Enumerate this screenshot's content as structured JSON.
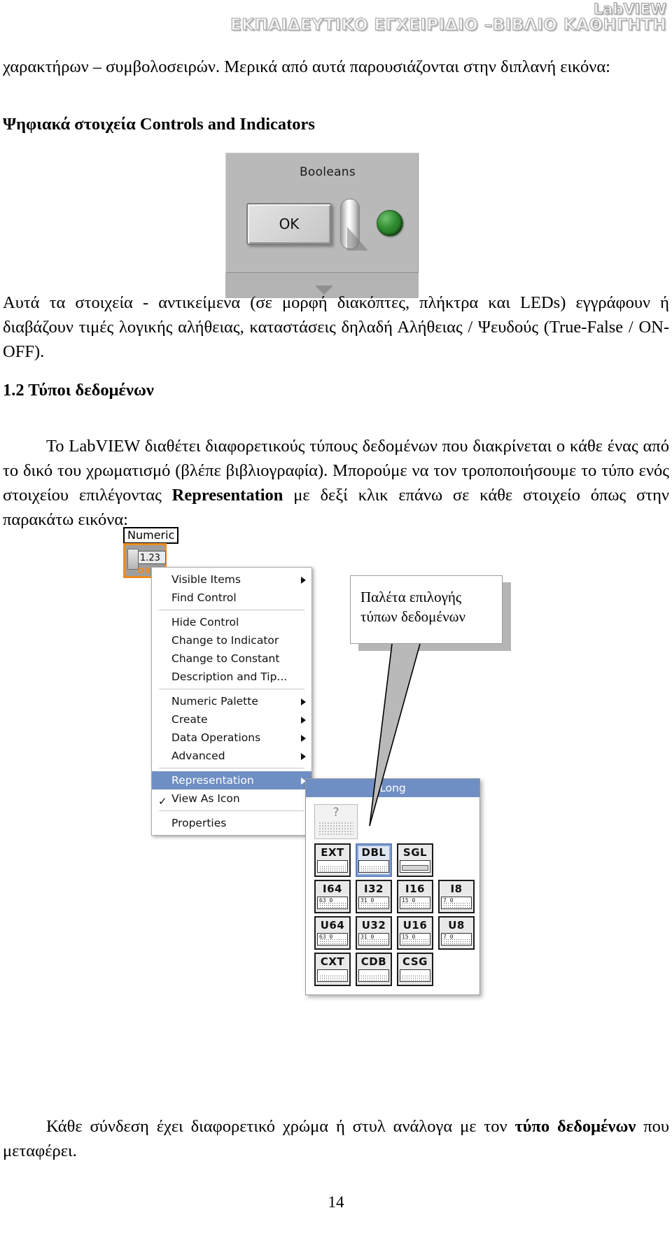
{
  "header": {
    "line1": "LabVIEW",
    "line2": "ΕΚΠΑΙΔΕΥΤΙΚΟ ΕΓΧΕΙΡΙΔΙΟ –ΒΙΒΛΙΟ ΚΑΘΗΓΗΤΗ"
  },
  "body": {
    "intro": "χαρακτήρων – συμβολοσειρών.  Μερικά από αυτά παρουσιάζονται στην διπλανή εικόνα:",
    "heading_digital": "Ψηφιακά στοιχεία  Controls and Indicators",
    "para_auta": "Αυτά τα στοιχεία - αντικείμενα (σε μορφή διακόπτες, πλήκτρα και LEDs) εγγράφουν ή διαβάζουν τιμές λογικής αλήθειας, καταστάσεις δηλαδή Αλήθειας / Ψευδούς (True-False / ON-OFF).",
    "heading_12": "1.2 Τύποι δεδομένων",
    "para_lab_1": "Το LabVIEW διαθέτει διαφορετικούς τύπους δεδομένων που διακρίνεται ο κάθε ένας από το δικό του χρωματισμό (βλέπε βιβλιογραφία). Μπορούμε να τον τροποποιήσουμε το τύπο ενός στοιχείου επιλέγοντας ",
    "para_lab_bold": "Representation",
    "para_lab_2": " με δεξί κλικ επάνω σε κάθε στοιχείο όπως στην παρακάτω εικόνα:",
    "para_kathe_1": "Κάθε σύνδεση έχει διαφορετικό χρώμα ή στυλ ανάλογα με τον ",
    "para_kathe_bold1": "τύπο δεδομένων",
    "para_kathe_2": " που μεταφέρει.",
    "page_number": "14"
  },
  "booleans_panel": {
    "title": "Booleans",
    "ok_button": "OK",
    "toggle_name": "vertical-toggle-switch",
    "led_name": "round-led",
    "led_color": "#2e8b2e",
    "panel_color": "#b9b9b9"
  },
  "numeric_control": {
    "label": "Numeric",
    "value": "1.23",
    "representation_badge": "DBL",
    "highlight_color": "#ef8c21"
  },
  "context_menu": {
    "items": [
      {
        "label": "Visible Items",
        "submenu": true,
        "selected": false,
        "checked": false
      },
      {
        "label": "Find Control",
        "submenu": false,
        "selected": false,
        "checked": false
      },
      {
        "separator": true
      },
      {
        "label": "Hide Control",
        "submenu": false,
        "selected": false,
        "checked": false
      },
      {
        "label": "Change to Indicator",
        "submenu": false,
        "selected": false,
        "checked": false
      },
      {
        "label": "Change to Constant",
        "submenu": false,
        "selected": false,
        "checked": false
      },
      {
        "label": "Description and Tip...",
        "submenu": false,
        "selected": false,
        "checked": false
      },
      {
        "separator": true
      },
      {
        "label": "Numeric Palette",
        "submenu": true,
        "selected": false,
        "checked": false
      },
      {
        "label": "Create",
        "submenu": true,
        "selected": false,
        "checked": false
      },
      {
        "label": "Data Operations",
        "submenu": true,
        "selected": false,
        "checked": false
      },
      {
        "label": "Advanced",
        "submenu": true,
        "selected": false,
        "checked": false
      },
      {
        "separator": true
      },
      {
        "label": "Representation",
        "submenu": true,
        "selected": true,
        "checked": false
      },
      {
        "label": "View As Icon",
        "submenu": false,
        "selected": false,
        "checked": true
      },
      {
        "separator": true
      },
      {
        "label": "Properties",
        "submenu": false,
        "selected": false,
        "checked": false
      }
    ]
  },
  "type_palette": {
    "header": "Long",
    "unknown_tile": "?",
    "rows": [
      [
        {
          "name": "EXT",
          "selected": false,
          "range": ""
        },
        {
          "name": "DBL",
          "selected": true,
          "range": ""
        },
        {
          "name": "SGL",
          "selected": false,
          "range": ""
        }
      ],
      [
        {
          "name": "I64",
          "selected": false,
          "range": "63   0"
        },
        {
          "name": "I32",
          "selected": false,
          "range": "31   0"
        },
        {
          "name": "I16",
          "selected": false,
          "range": "15   0"
        },
        {
          "name": "I8",
          "selected": false,
          "range": "7  0"
        }
      ],
      [
        {
          "name": "U64",
          "selected": false,
          "range": "63   0"
        },
        {
          "name": "U32",
          "selected": false,
          "range": "31   0"
        },
        {
          "name": "U16",
          "selected": false,
          "range": "15   0"
        },
        {
          "name": "U8",
          "selected": false,
          "range": "7  0"
        }
      ],
      [
        {
          "name": "CXT",
          "selected": false,
          "range": ""
        },
        {
          "name": "CDB",
          "selected": false,
          "range": ""
        },
        {
          "name": "CSG",
          "selected": false,
          "range": ""
        }
      ]
    ]
  },
  "callout": {
    "line1": "Παλέτα επιλογής",
    "line2": "τύπων δεδομένων"
  }
}
